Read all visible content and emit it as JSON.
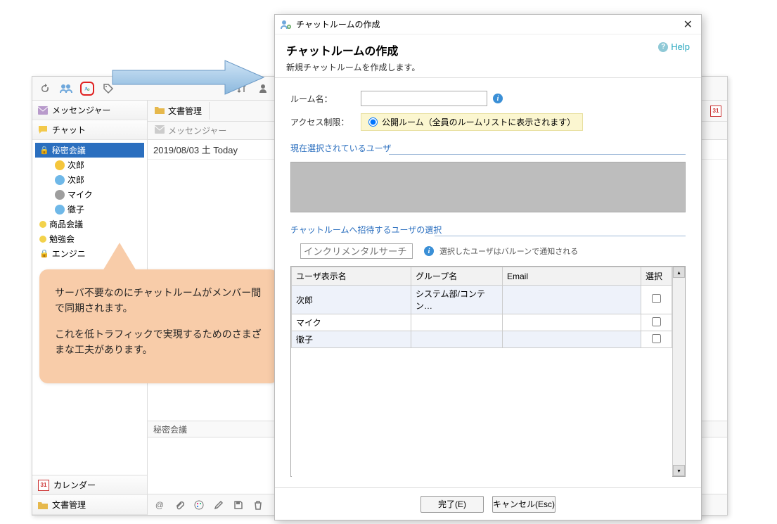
{
  "toolbar": {
    "icons": [
      "refresh-icon",
      "group-icon",
      "group-add-icon",
      "tag-icon",
      "tree-icon",
      "person-icon"
    ]
  },
  "sidebar": {
    "messenger_label": "メッセンジャー",
    "chat_label": "チャット",
    "calendar_label": "カレンダー",
    "docmgmt_label": "文書管理",
    "rooms": [
      {
        "name": "秘密会議",
        "locked": true,
        "selected": true,
        "members": [
          {
            "name": "次郎",
            "color": "#f5c63c"
          },
          {
            "name": "次郎",
            "color": "#6fb8e8"
          },
          {
            "name": "マイク",
            "color": "#9e9e9e"
          },
          {
            "name": "徹子",
            "color": "#6fb8e8"
          }
        ]
      },
      {
        "name": "商品会議",
        "dot": "#f3d24b"
      },
      {
        "name": "勉強会",
        "dot": "#f3d24b"
      },
      {
        "name": "エンジニ",
        "locked": true
      }
    ]
  },
  "content": {
    "tab_doc": "文書管理",
    "tab_messenger": "メッセンジャー",
    "cal31": "31",
    "date_header": "2019/08/03 土 Today",
    "room_header": "秘密会議"
  },
  "callout": {
    "p1": "サーバ不要なのにチャットルームがメンバー間で同期されます。",
    "p2": "これを低トラフィックで実現するためのさまざまな工夫があります。"
  },
  "dialog": {
    "window_title": "チャットルームの作成",
    "heading": "チャットルームの作成",
    "subheading": "新規チャットルームを作成します。",
    "help": "Help",
    "room_name_label": "ルーム名：",
    "access_label": "アクセス制限：",
    "access_radio": "公開ルーム（全員のルームリストに表示されます）",
    "selected_users_title": "現在選択されているユーザ",
    "invite_users_title": "チャットルームへ招待するユーザの選択",
    "search_placeholder": "インクリメンタルサーチ",
    "balloon_hint": "選択したユーザはバルーンで通知される",
    "table_headers": {
      "name": "ユーザ表示名",
      "group": "グループ名",
      "email": "Email",
      "select": "選択"
    },
    "users": [
      {
        "name": "次郎",
        "group": "システム部/コンテン…",
        "email": ""
      },
      {
        "name": "マイク",
        "group": "",
        "email": ""
      },
      {
        "name": "徹子",
        "group": "",
        "email": ""
      }
    ],
    "btn_done": "完了(E)",
    "btn_cancel": "キャンセル(Esc)"
  }
}
